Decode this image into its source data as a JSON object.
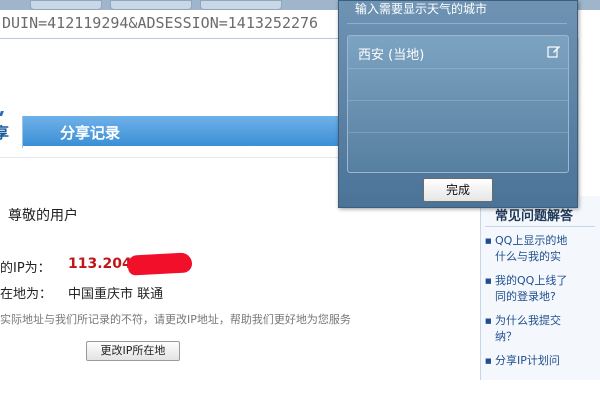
{
  "browser": {
    "url": "DUIN=412119294&ADSESSION=1413252276"
  },
  "tabs": {
    "active_label": "享",
    "share_label": "分享记录"
  },
  "content": {
    "greeting": "尊敬的用户",
    "ip_label": "的IP为：",
    "ip_value": "113.204.",
    "location_label": "在地为：",
    "location_value": "中国重庆市 联通",
    "notice": "实际地址与我们所记录的不符，请更改IP地址，帮助我们更好地为您服务",
    "change_button": "更改IP所在地"
  },
  "faq": {
    "title": "常见问题解答",
    "items": [
      "QQ上显示的地",
      "什么与我的实",
      "我的QQ上线了",
      "同的登录地?",
      "为什么我提交",
      "纳？",
      "分享IP计划问"
    ]
  },
  "weather_popup": {
    "hint": "输入需要显示天气的城市",
    "city": "西安 (当地)",
    "done_button": "完成"
  },
  "colors": {
    "ip_value": "#c0161b",
    "tab_bar": "#3b8fd5",
    "popup_bg": "#4b7398"
  }
}
